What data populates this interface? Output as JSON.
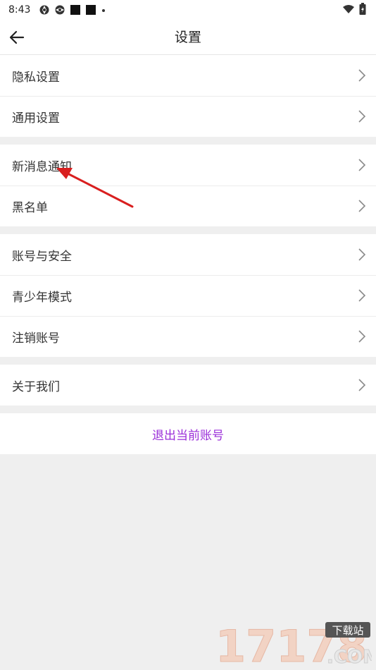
{
  "status": {
    "time": "8:43"
  },
  "header": {
    "title": "设置"
  },
  "groups": [
    [
      {
        "label": "隐私设置"
      },
      {
        "label": "通用设置"
      }
    ],
    [
      {
        "label": "新消息通知"
      },
      {
        "label": "黑名单"
      }
    ],
    [
      {
        "label": "账号与安全"
      },
      {
        "label": "青少年模式"
      },
      {
        "label": "注销账号"
      }
    ],
    [
      {
        "label": "关于我们"
      }
    ]
  ],
  "logout_label": "退出当前账号",
  "colors": {
    "accent": "#9b2fd9",
    "annotation_arrow": "#d91f1f"
  },
  "watermark": {
    "number": "17178",
    "badge": "下载站",
    "domain": ".COM"
  }
}
